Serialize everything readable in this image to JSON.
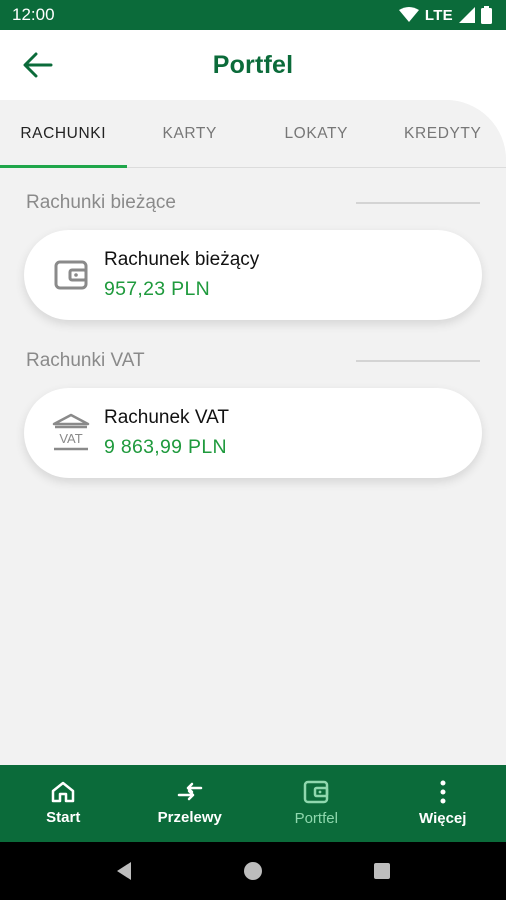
{
  "status_bar": {
    "time": "12:00",
    "network": "LTE"
  },
  "header": {
    "title": "Portfel"
  },
  "tabs": [
    {
      "label": "RACHUNKI",
      "active": true
    },
    {
      "label": "KARTY",
      "active": false
    },
    {
      "label": "LOKATY",
      "active": false
    },
    {
      "label": "KREDYTY",
      "active": false
    }
  ],
  "sections": [
    {
      "title": "Rachunki bieżące",
      "account": {
        "name": "Rachunek bieżący",
        "amount": "957,23 PLN",
        "icon": "wallet-icon"
      }
    },
    {
      "title": "Rachunki VAT",
      "account": {
        "name": "Rachunek VAT",
        "amount": "9 863,99 PLN",
        "icon": "vat-bank-icon"
      }
    }
  ],
  "bottom_nav": [
    {
      "label": "Start",
      "icon": "home-icon"
    },
    {
      "label": "Przelewy",
      "icon": "transfer-arrows-icon"
    },
    {
      "label": "Portfel",
      "icon": "wallet-icon",
      "active": true
    },
    {
      "label": "Więcej",
      "icon": "more-dots-icon"
    }
  ],
  "colors": {
    "brand": "#0b6b3a",
    "accent": "#1fa64a",
    "amount": "#1f9a3d",
    "background": "#f2f2f2"
  }
}
